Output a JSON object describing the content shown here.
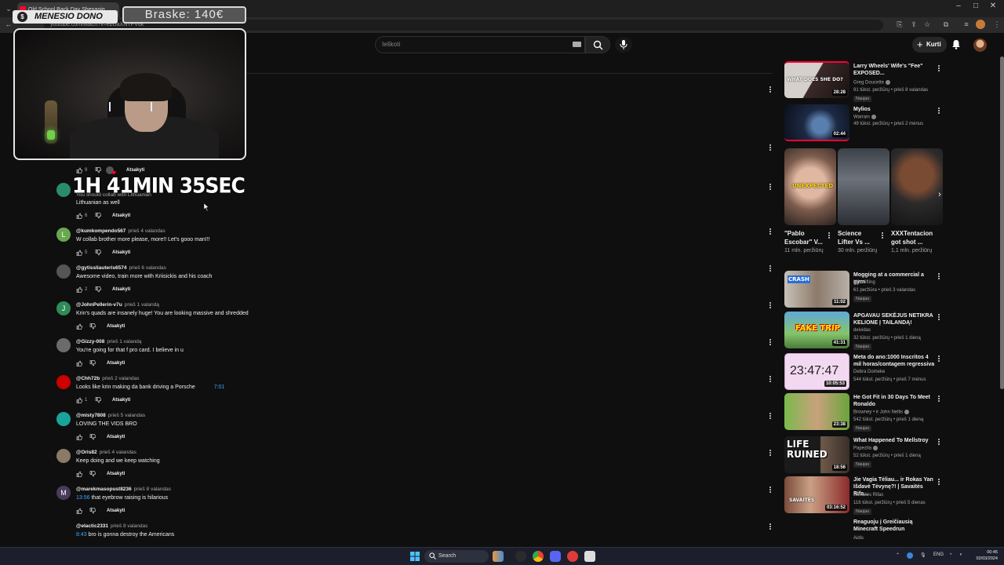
{
  "browser": {
    "tab_title": "Old School Back Day Shenanig...",
    "url": "youtube.com/watch?v=ebUaXNTPV6k"
  },
  "overlay": {
    "streamer_name": "MENESIO DONO",
    "donation": "Braske: 140€",
    "timer": "1H 41MIN 35SEC"
  },
  "youtube": {
    "search_placeholder": "Ieškoti",
    "create_label": "Kurti"
  },
  "comments": [
    {
      "text_fragment": "You should collab with Lithuanian",
      "text": "Lithuanian as well",
      "likes": "6",
      "reply": "Atsakyti"
    },
    {
      "handle": "@kumkompendo567",
      "time": "prieš 4 valandas",
      "text": "W collab brother more please, more!! Let's gooo man!!!",
      "likes": "5",
      "reply": "Atsakyti",
      "avatar": "L",
      "avatar_color": "#6aa84f"
    },
    {
      "handle": "@gytissliauteris6574",
      "time": "prieš 6 valandas",
      "text": "Awesome video, train more with Kriisickis and his coach",
      "likes": "2",
      "reply": "Atsakyti",
      "avatar_color": "#555555"
    },
    {
      "handle": "@JohnPellerin-v7u",
      "time": "prieš 1 valandą",
      "text": "Krin's quads are insanely huge! You are looking massive and shredded",
      "likes": "",
      "reply": "Atsakyti",
      "avatar": "J",
      "avatar_color": "#2e8b57"
    },
    {
      "handle": "@Gizzy-008",
      "time": "prieš 1 valandą",
      "text": "You're going for that f pro card. I believe in u",
      "likes": "",
      "reply": "Atsakyti",
      "avatar_color": "#6b6b6b"
    },
    {
      "handle": "@Chh72b",
      "time": "prieš 2 valandas",
      "text": "Looks like krin making da bank driving a Porsche",
      "timestamp": "7:01",
      "likes": "1",
      "reply": "Atsakyti",
      "avatar_color": "#cc0000"
    },
    {
      "handle": "@misty7808",
      "time": "prieš 5 valandas",
      "text": "LOVING THE VIDS BRO",
      "likes": "",
      "reply": "Atsakyti",
      "avatar_color": "#1aa39a"
    },
    {
      "handle": "@Oris82",
      "time": "prieš 4 valandas",
      "text": "Keep doing and we keep watching",
      "likes": "",
      "reply": "Atsakyti",
      "avatar_color": "#8a7a66"
    },
    {
      "handle": "@marekmasopust8236",
      "time": "prieš 8 valandas",
      "timestamp": "13:56",
      "text": "that eyebrow raising is hilarious",
      "likes": "",
      "reply": "Atsakyti",
      "avatar": "M",
      "avatar_color": "#4a3b5c"
    },
    {
      "handle": "@elactic2331",
      "time": "prieš 8 valandas",
      "timestamp": "8:43",
      "text": "bro is gonna destroy the Americans",
      "likes": "",
      "reply": "Atsakyti"
    }
  ],
  "top_comment_actions": {
    "likes": "9",
    "reply": "Atsakyti"
  },
  "sidebar": {
    "videos_top": [
      {
        "title": "Larry Wheels' Wife's \"Fee\" EXPOSED...",
        "channel": "Greg Doucette",
        "meta": "91 tūkst. peržiūrų • prieš 8 valandas",
        "badge": "Naujas",
        "duration": "28:28",
        "thumb_text": "WHAT DOES SHE DO?"
      },
      {
        "title": "Mylios",
        "channel": "Warrain",
        "meta": "49 tūkst. peržiūrų • prieš 2 mėnus",
        "badge": "",
        "duration": "02:44"
      }
    ],
    "shorts": [
      {
        "title": "\"Pablo Escobar\" V...",
        "views": "11 mln. peržiūrų",
        "thumb_text": "UNEXPECTED"
      },
      {
        "title": "Science Lifter Vs ...",
        "views": "30 mln. peržiūrų"
      },
      {
        "title": "XXXTentacion got shot ...",
        "views": "1,1 mln. peržiūrų"
      }
    ],
    "videos_bottom": [
      {
        "title": "Mogging at a commercial a gym",
        "channel": "Niko lifting",
        "meta": "61 peržiūra • prieš 3 valandas",
        "badge": "Naujas",
        "duration": "11:02",
        "thumb_text": "CRASH"
      },
      {
        "title": "APGAVAU SEKĖJUS NETIKRA KELIONE Į TAILANDĄ!",
        "channel": "deividas",
        "meta": "32 tūkst. peržiūrų • prieš 1 dieną",
        "badge": "Naujas",
        "duration": "41:31",
        "thumb_text": "FAKE TRIP"
      },
      {
        "title": "Meta do ano:1000 Inscritos 4 mil horas/contagem regressiva",
        "channel": "Debra Domeke",
        "meta": "544 tūkst. peržiūrų • prieš 7 mėnus",
        "badge": "",
        "duration": "10:05:53",
        "thumb_text": "23:47:47"
      },
      {
        "title": "He Got Fit in 30 Days To Meet Ronaldo",
        "channel": "Browney • ir John Nellis",
        "meta": "542 tūkst. peržiūrų • prieš 1 dieną",
        "badge": "Naujas",
        "duration": "23:38"
      },
      {
        "title": "What Happened To Mellstroy",
        "channel": "Papezila",
        "meta": "52 tūkst. peržiūrų • prieš 1 dieną",
        "badge": "Naujas",
        "duration": "18:56",
        "thumb_text": "LIFE RUINED"
      },
      {
        "title": "Jie Vagia Tėliau... ir Rokas Yan Išdavė Tėvynę?! | Savaitės Rifa...",
        "channel": "Savaitės Rifas",
        "meta": "116 tūkst. peržiūrų • prieš 5 dienas",
        "badge": "Naujas",
        "duration": "03:16:52",
        "thumb_text": "SAVAITĖS"
      },
      {
        "title": "Reaguoju į Greičiausią Minecraft Speedrun",
        "channel": "Aidis",
        "meta": "",
        "badge": ""
      }
    ]
  },
  "taskbar": {
    "search_label": "Search",
    "lang": "ENG",
    "time": "00:45",
    "date": "02/03/2024"
  },
  "colors": {
    "background": "#0f0f0f",
    "accent_red": "#ff0033",
    "link_blue": "#3ea6ff"
  }
}
